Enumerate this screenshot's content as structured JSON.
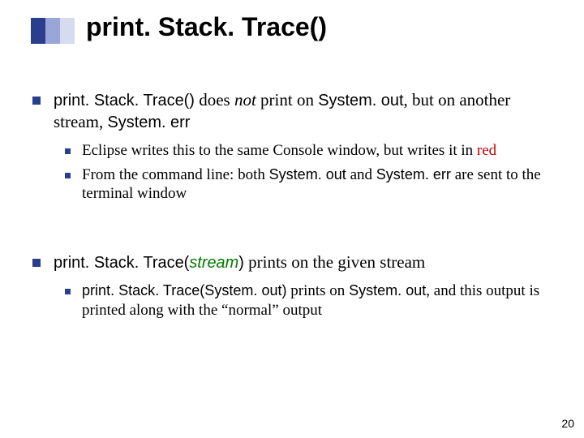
{
  "title": "print. Stack. Trace()",
  "p1": {
    "method": "print. Stack. Trace()",
    "t1": " does ",
    "not": "not",
    "t2": " print on ",
    "sysout": "System. out",
    "t3": ", but on another stream, ",
    "syserr": "System. err"
  },
  "sub1": {
    "a": "Eclipse writes this to the same Console window, but writes it in ",
    "red": "red",
    "b1": "From the command line: both ",
    "b_sysout": "System. out",
    "b2": " and ",
    "b_syserr": "System. err",
    "b3": " are sent to the terminal window"
  },
  "p2": {
    "prefix": "print. Stack. Trace(",
    "arg": "stream",
    "suffix": ")",
    "rest": " prints on the given stream"
  },
  "sub2": {
    "code": "print. Stack. Trace(System. out)",
    "t1": " prints on ",
    "sysout": "System. out",
    "t2": ", and this output is printed along with the “normal” output"
  },
  "page": "20"
}
